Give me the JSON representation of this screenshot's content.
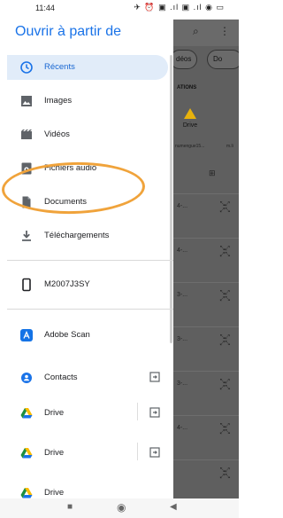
{
  "status": {
    "time": "11:44",
    "right_icons": "✈ ⏰ ▣ .ıl ▣ .ıl ◉ ▭"
  },
  "drawer": {
    "title": "Ouvrir à partir de",
    "items": [
      {
        "label": "Récents",
        "icon": "clock-icon",
        "active": true
      },
      {
        "label": "Images",
        "icon": "image-icon"
      },
      {
        "label": "Vidéos",
        "icon": "video-icon"
      },
      {
        "label": "Fichiers audio",
        "icon": "audio-icon"
      },
      {
        "label": "Documents",
        "icon": "document-icon"
      },
      {
        "label": "Téléchargements",
        "icon": "download-icon"
      },
      {
        "label": "M2007J3SY",
        "icon": "phone-icon"
      },
      {
        "label": "Adobe Scan",
        "icon": "adobe-scan-icon"
      },
      {
        "label": "Contacts",
        "icon": "contacts-icon"
      },
      {
        "label": "Drive",
        "icon": "drive-icon"
      },
      {
        "label": "Drive",
        "icon": "drive-icon"
      },
      {
        "label": "Drive",
        "icon": "drive-icon"
      }
    ]
  },
  "background": {
    "chips": [
      "déos",
      "Do"
    ],
    "section": "ATIONS",
    "drive_label": "Drive",
    "drive_sub": [
      "numengue15...",
      "m.li"
    ],
    "rows": [
      "4-...",
      "4-...",
      "3-...",
      "3-...",
      "3-...",
      "4-..."
    ]
  },
  "colors": {
    "accent": "#1a73e8",
    "active_bg": "#e1ecf9",
    "marker": "#f0a33b"
  }
}
